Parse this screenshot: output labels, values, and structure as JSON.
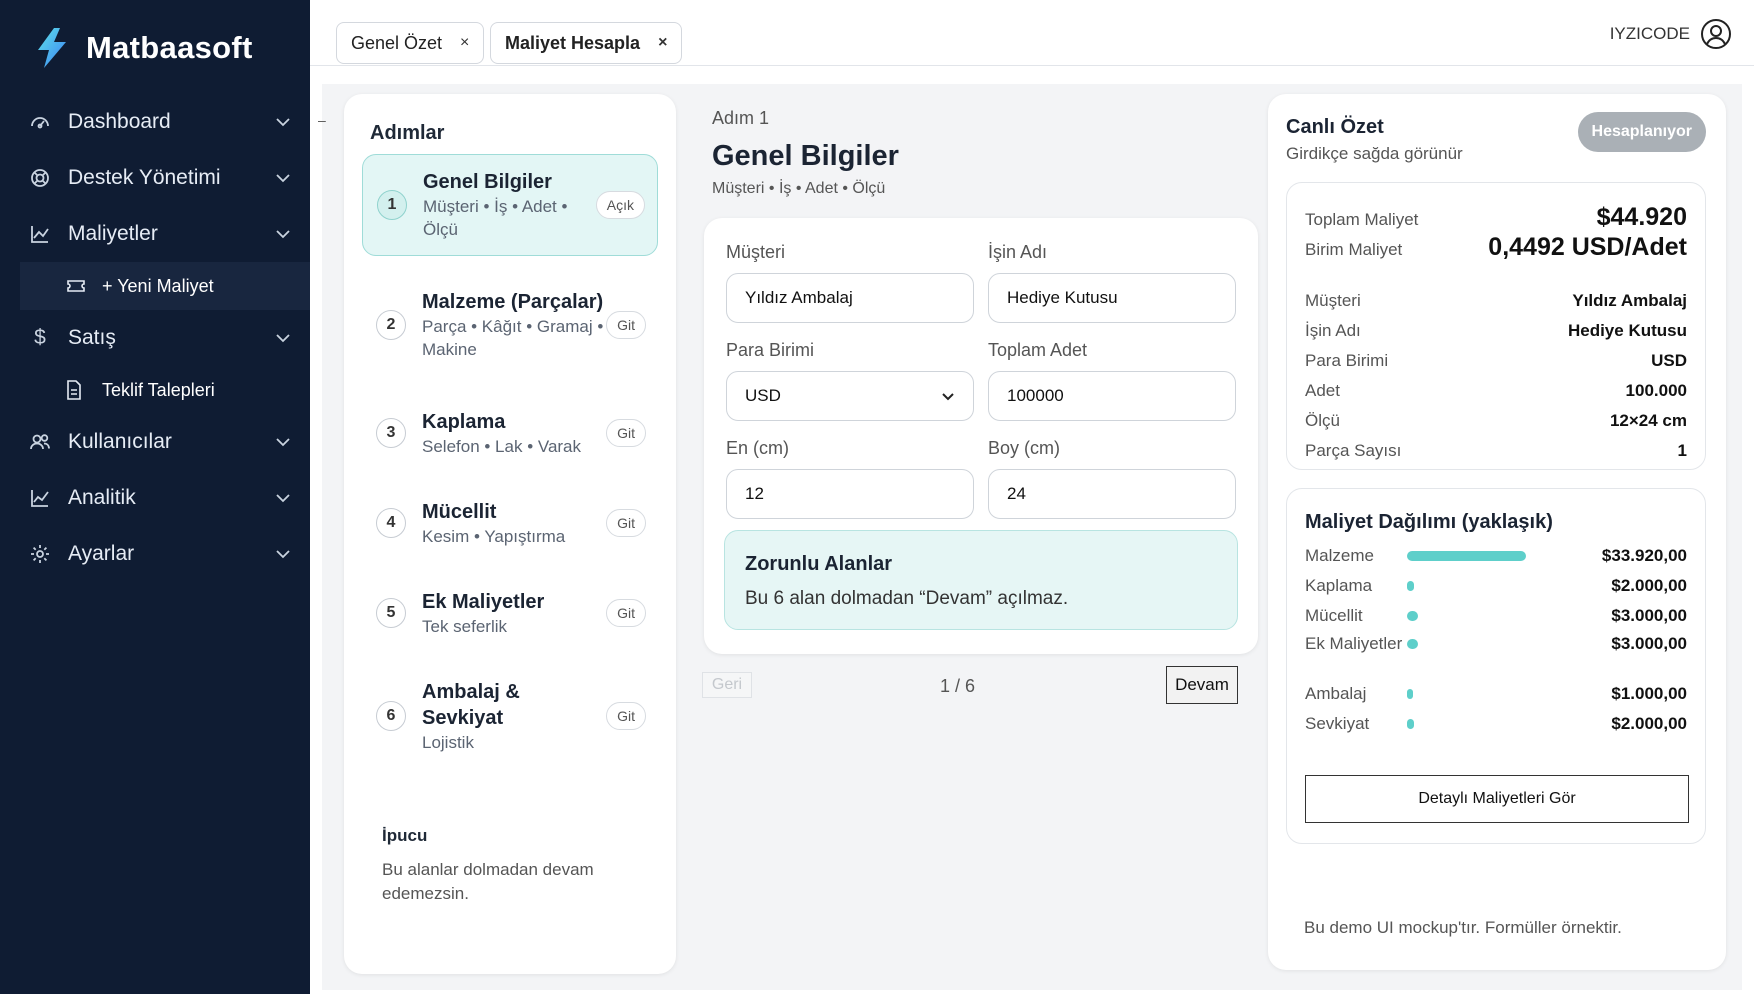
{
  "brand": {
    "name": "Matbaasoft"
  },
  "sidebar": {
    "items": [
      {
        "label": "Dashboard",
        "icon": "dashboard-icon"
      },
      {
        "label": "Destek Yönetimi",
        "icon": "support-icon"
      },
      {
        "label": "Maliyetler",
        "icon": "chart-line-icon"
      },
      {
        "label": "+ Yeni Maliyet",
        "icon": "ticket-icon",
        "sub": true,
        "active": true
      },
      {
        "label": "Satış",
        "icon": "dollar-icon"
      },
      {
        "label": "Teklif Talepleri",
        "icon": "document-icon",
        "sub": true
      },
      {
        "label": "Kullanıcılar",
        "icon": "users-icon"
      },
      {
        "label": "Analitik",
        "icon": "analytics-icon"
      },
      {
        "label": "Ayarlar",
        "icon": "gear-icon"
      }
    ]
  },
  "header": {
    "tabs": [
      {
        "label": "Genel Özet",
        "close": "×"
      },
      {
        "label": "Maliyet Hesapla",
        "close": "×"
      }
    ],
    "user": "IYZICODE"
  },
  "steps": {
    "title": "Adımlar",
    "items": [
      {
        "num": "1",
        "title": "Genel Bilgiler",
        "desc": "Müşteri • İş • Adet • Ölçü",
        "action": "Açık"
      },
      {
        "num": "2",
        "title": "Malzeme (Parçalar)",
        "desc": "Parça • Kâğıt • Gramaj • Makine",
        "action": "Git"
      },
      {
        "num": "3",
        "title": "Kaplama",
        "desc": "Selefon • Lak • Varak",
        "action": "Git"
      },
      {
        "num": "4",
        "title": "Mücellit",
        "desc": "Kesim • Yapıştırma",
        "action": "Git"
      },
      {
        "num": "5",
        "title": "Ek Maliyetler",
        "desc": "Tek seferlik",
        "action": "Git"
      },
      {
        "num": "6",
        "title": "Ambalaj & Sevkiyat",
        "desc": "Lojistik",
        "action": "Git"
      }
    ],
    "tip_title": "İpucu",
    "tip_text": "Bu alanlar dolmadan devam edemezsin."
  },
  "form": {
    "step_label": "Adım 1",
    "title": "Genel Bilgiler",
    "subtitle": "Müşteri • İş • Adet • Ölçü",
    "customer_label": "Müşteri",
    "customer_value": "Yıldız Ambalaj",
    "job_label": "İşin Adı",
    "job_value": "Hediye Kutusu",
    "currency_label": "Para Birimi",
    "currency_value": "USD",
    "qty_label": "Toplam Adet",
    "qty_value": "100000",
    "width_label": "En (cm)",
    "width_value": "12",
    "height_label": "Boy (cm)",
    "height_value": "24",
    "required_title": "Zorunlu Alanlar",
    "required_text": "Bu 6 alan dolmadan “Devam” açılmaz.",
    "back": "Geri",
    "pager": "1 / 6",
    "next": "Devam"
  },
  "summary": {
    "title": "Canlı Özet",
    "subtitle": "Girdikçe sağda görünür",
    "badge": "Hesaplanıyor",
    "total_label": "Toplam Maliyet",
    "total_value": "$44.920",
    "unit_label": "Birim Maliyet",
    "unit_value": "0,4492 USD/Adet",
    "details": [
      {
        "k": "Müşteri",
        "v": "Yıldız Ambalaj"
      },
      {
        "k": "İşin Adı",
        "v": "Hediye Kutusu"
      },
      {
        "k": "Para Birimi",
        "v": "USD"
      },
      {
        "k": "Adet",
        "v": "100.000"
      },
      {
        "k": "Ölçü",
        "v": "12×24 cm"
      },
      {
        "k": "Parça Sayısı",
        "v": "1"
      }
    ],
    "breakdown_title": "Maliyet Dağılımı (yaklaşık)",
    "breakdown": [
      {
        "k": "Malzeme",
        "v": "$33.920,00",
        "share": 0.7551
      },
      {
        "k": "Kaplama",
        "v": "$2.000,00",
        "share": 0.0445
      },
      {
        "k": "Mücellit",
        "v": "$3.000,00",
        "share": 0.0668
      },
      {
        "k": "Ek Maliyetler",
        "v": "$3.000,00",
        "share": 0.0668
      },
      {
        "k": "Ambalaj",
        "v": "$1.000,00",
        "share": 0.0223
      },
      {
        "k": "Sevkiyat",
        "v": "$2.000,00",
        "share": 0.0445
      }
    ],
    "detail_button": "Detaylı Maliyetleri Gör",
    "note": "Bu demo UI mockup'tır. Formüller örnektir.",
    "accent": "#5ecfca"
  }
}
